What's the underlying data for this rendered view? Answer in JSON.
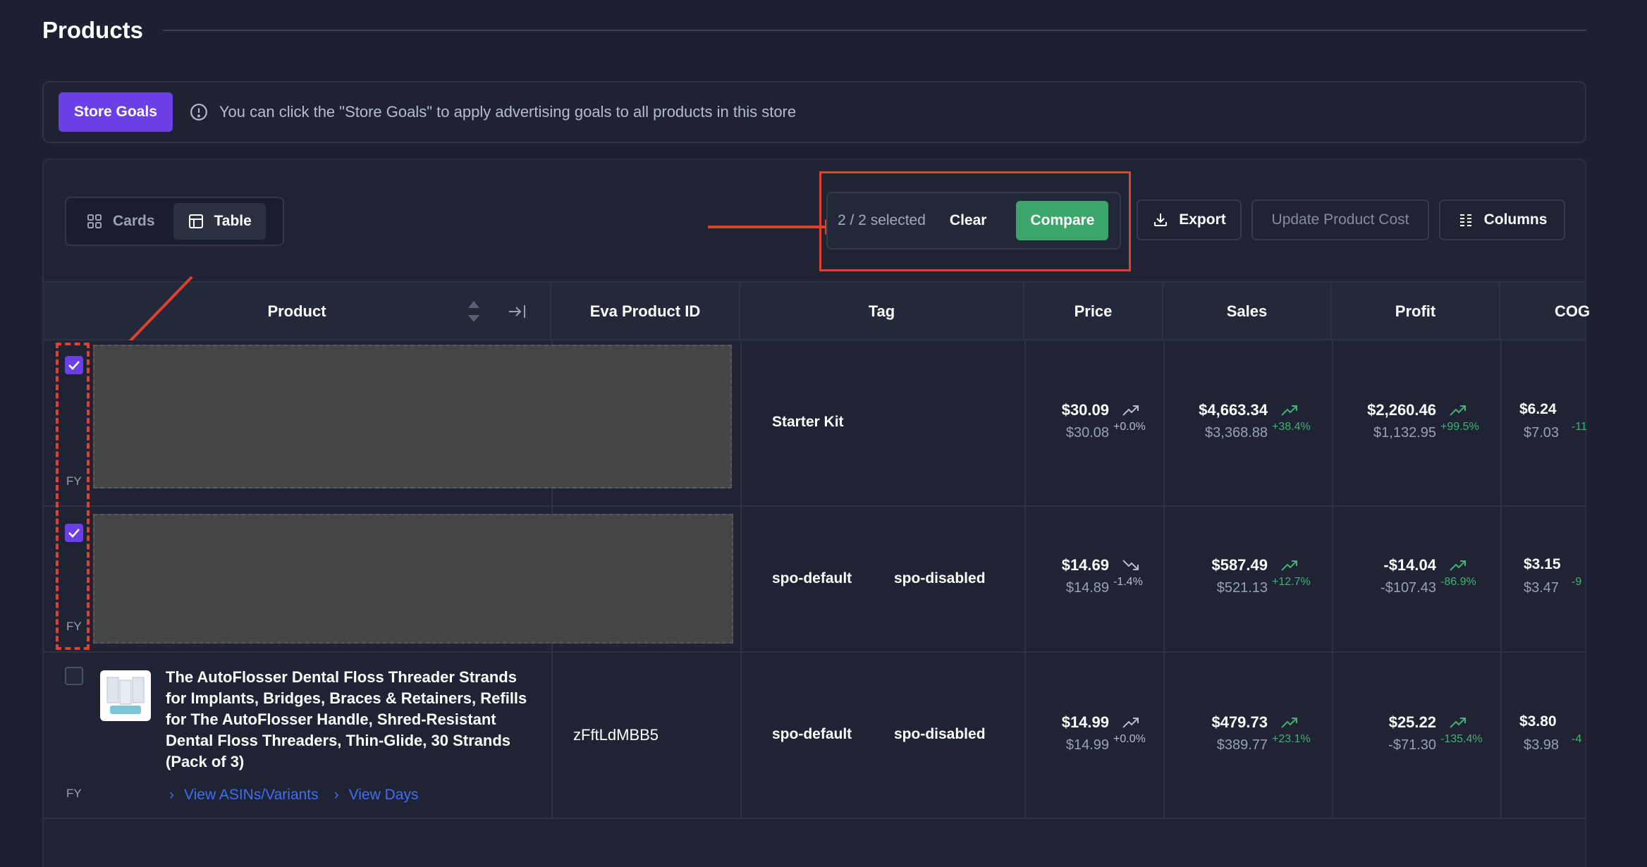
{
  "page": {
    "title": "Products"
  },
  "banner": {
    "button_label": "Store Goals",
    "message": "You can click the \"Store Goals\" to apply advertising goals to all products in this store"
  },
  "view_toggle": {
    "cards_label": "Cards",
    "table_label": "Table",
    "active": "Table"
  },
  "selection": {
    "count_label": "2 / 2 selected",
    "clear_label": "Clear",
    "compare_label": "Compare"
  },
  "toolbar": {
    "export_label": "Export",
    "update_cost_label": "Update Product Cost",
    "columns_label": "Columns"
  },
  "table": {
    "headers": {
      "product": "Product",
      "eva_id": "Eva Product ID",
      "tag": "Tag",
      "price": "Price",
      "sales": "Sales",
      "profit": "Profit",
      "cog": "COG"
    },
    "rows": [
      {
        "checked": true,
        "fy": "FY",
        "tags": [
          "Starter Kit"
        ],
        "price": {
          "value": "$30.09",
          "previous": "$30.08",
          "delta": "+0.0%",
          "trend": "up"
        },
        "sales": {
          "value": "$4,663.34",
          "previous": "$3,368.88",
          "delta": "+38.4%",
          "trend": "up"
        },
        "profit": {
          "value": "$2,260.46",
          "previous": "$1,132.95",
          "delta": "+99.5%",
          "trend": "up"
        },
        "cog": {
          "value": "$6.24",
          "previous": "$7.03",
          "delta": "-11"
        }
      },
      {
        "checked": true,
        "fy": "FY",
        "tags": [
          "spo-default",
          "spo-disabled"
        ],
        "price": {
          "value": "$14.69",
          "previous": "$14.89",
          "delta": "-1.4%",
          "trend": "down"
        },
        "sales": {
          "value": "$587.49",
          "previous": "$521.13",
          "delta": "+12.7%",
          "trend": "up"
        },
        "profit": {
          "value": "-$14.04",
          "previous": "-$107.43",
          "delta": "-86.9%",
          "trend": "up"
        },
        "cog": {
          "value": "$3.15",
          "previous": "$3.47",
          "delta": "-9"
        }
      },
      {
        "checked": false,
        "fy": "FY",
        "title": "The AutoFlosser Dental Floss Threader Strands for Implants, Bridges, Braces & Retainers, Refills for The AutoFlosser Handle, Shred-Resistant Dental Floss Threaders, Thin-Glide, 30 Strands (Pack of 3)",
        "links": [
          "View ASINs/Variants",
          "View Days"
        ],
        "eva_id": "zFftLdMBB5",
        "tags": [
          "spo-default",
          "spo-disabled"
        ],
        "price": {
          "value": "$14.99",
          "previous": "$14.99",
          "delta": "+0.0%",
          "trend": "up"
        },
        "sales": {
          "value": "$479.73",
          "previous": "$389.77",
          "delta": "+23.1%",
          "trend": "up"
        },
        "profit": {
          "value": "$25.22",
          "previous": "-$71.30",
          "delta": "-135.4%",
          "trend": "up"
        },
        "cog": {
          "value": "$3.80",
          "previous": "$3.98",
          "delta": "-4"
        }
      }
    ]
  },
  "colors": {
    "accent_purple": "#6a40e6",
    "compare_green": "#3ba66b",
    "annotation_red": "#e0412f",
    "link_blue": "#3f6ff0",
    "positive": "#3fb36f"
  }
}
